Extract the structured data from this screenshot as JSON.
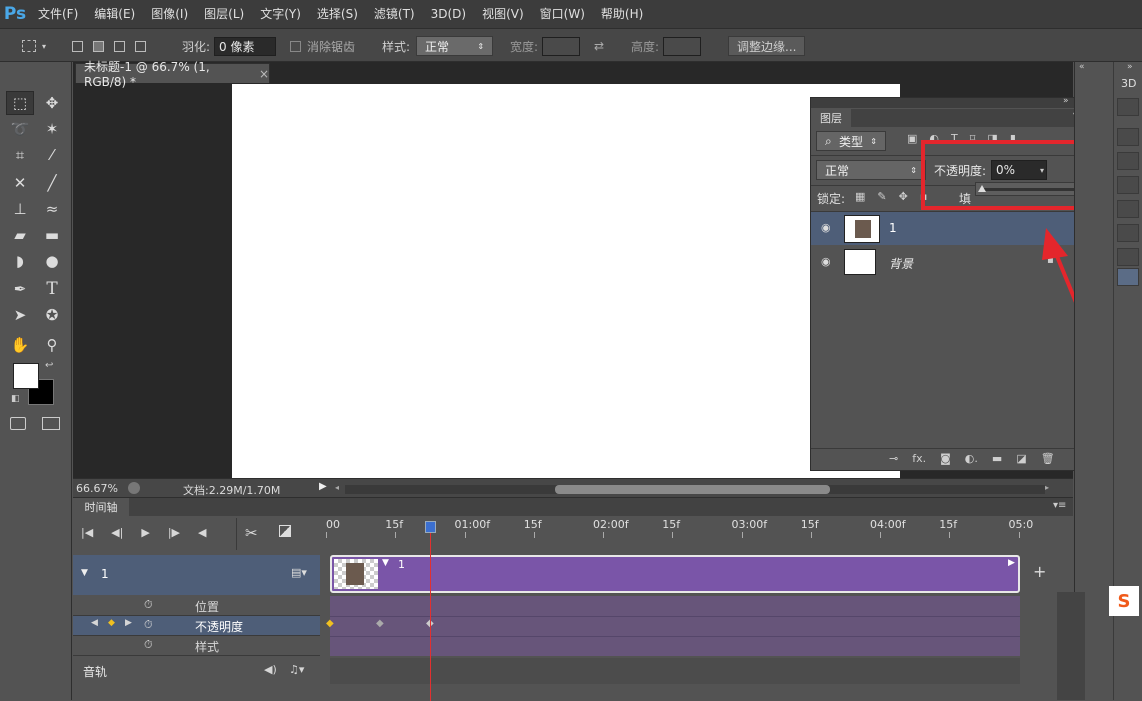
{
  "app": {
    "logo": "Ps"
  },
  "menu": [
    "文件(F)",
    "编辑(E)",
    "图像(I)",
    "图层(L)",
    "文字(Y)",
    "选择(S)",
    "滤镜(T)",
    "3D(D)",
    "视图(V)",
    "窗口(W)",
    "帮助(H)"
  ],
  "options": {
    "feather_label": "羽化:",
    "feather_value": "0 像素",
    "antialias_label": "消除锯齿",
    "style_label": "样式:",
    "style_value": "正常",
    "width_label": "宽度:",
    "height_label": "高度:",
    "refine_edge_label": "调整边缘..."
  },
  "document": {
    "tab_title": "未标题-1 @ 66.7% (1, RGB/8) *",
    "close": "×",
    "zoom": "66.67%",
    "doc_info": "文档:2.29M/1.70M"
  },
  "layers_panel": {
    "title": "图层",
    "filter_label": "类型",
    "blend_mode": "正常",
    "opacity_label": "不透明度:",
    "opacity_value": "0%",
    "opacity_fraction": 0,
    "lock_label": "锁定:",
    "fill_label": "填",
    "layers": [
      {
        "name": "1",
        "selected": true,
        "thumb": "photo"
      },
      {
        "name": "背景",
        "selected": false,
        "thumb": "white"
      }
    ]
  },
  "timeline": {
    "title": "时间轴",
    "ruler": [
      "00",
      "15f",
      "01:00f",
      "15f",
      "02:00f",
      "15f",
      "03:00f",
      "15f",
      "04:00f",
      "15f",
      "05:0"
    ],
    "track_name": "1",
    "clip_label": "1",
    "properties": [
      "位置",
      "不透明度",
      "样式"
    ],
    "audio_label": "音轨",
    "add_label": "+"
  },
  "dock": {
    "label_3d": "3D"
  },
  "colors": {
    "accent_red": "#e4262c",
    "clip_purple": "#7a55a8",
    "playhead": "#e23030",
    "selected_row": "#4e5e78"
  }
}
